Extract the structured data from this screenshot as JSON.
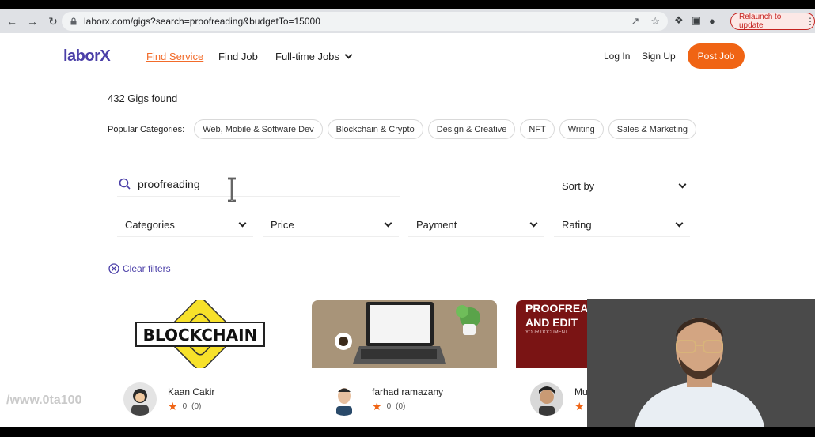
{
  "browser": {
    "url": "laborx.com/gigs?search=proofreading&budgetTo=15000",
    "relaunch_label": "Relaunch to update"
  },
  "nav": {
    "logo": "laborX",
    "find_service": "Find Service",
    "find_job": "Find Job",
    "fulltime_jobs": "Full-time Jobs",
    "login": "Log In",
    "signup": "Sign Up",
    "post_job": "Post Job"
  },
  "results": {
    "found": "432 Gigs found"
  },
  "popular": {
    "label": "Popular Categories:",
    "chips": [
      "Web, Mobile & Software Dev",
      "Blockchain & Crypto",
      "Design & Creative",
      "NFT",
      "Writing",
      "Sales & Marketing"
    ]
  },
  "search": {
    "value": "proofreading"
  },
  "sort": {
    "label": "Sort by"
  },
  "filters": {
    "categories": "Categories",
    "price": "Price",
    "payment": "Payment",
    "rating": "Rating"
  },
  "clear_filters": "Clear filters",
  "cards": [
    {
      "image_text": "BLOCKCHAIN",
      "author": "Kaan Cakir",
      "rating": "0",
      "reviews": "(0)"
    },
    {
      "image_text": "",
      "author": "farhad ramazany",
      "rating": "0",
      "reviews": "(0)"
    },
    {
      "image_text_1": "PROOFREA",
      "image_text_2": "AND EDIT",
      "image_text_3": "YOUR DOCUMENT",
      "author": "Mu",
      "rating": "",
      "reviews": ""
    }
  ],
  "watermark": "/www.0ta100",
  "colors": {
    "brand": "#4b3fa8",
    "accent": "#f06414"
  }
}
